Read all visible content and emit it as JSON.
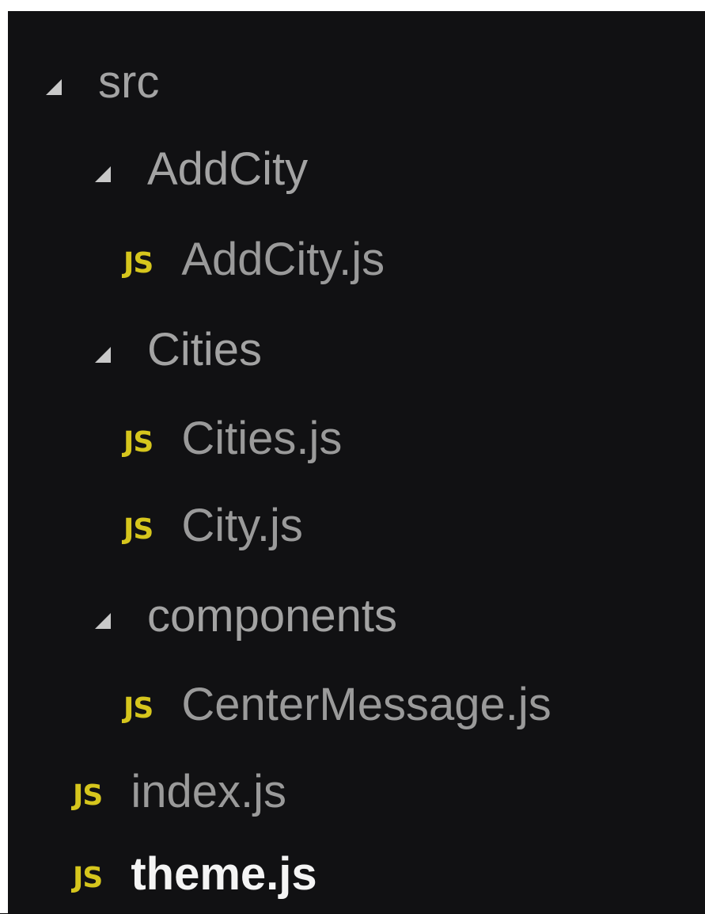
{
  "tree": {
    "src": {
      "label": "src",
      "icon": "chevron-down-icon"
    },
    "addcity_folder": {
      "label": "AddCity",
      "icon": "chevron-down-icon"
    },
    "addcity_js": {
      "label": "AddCity.js",
      "icon": "js-file-icon",
      "badge": "JS"
    },
    "cities_folder": {
      "label": "Cities",
      "icon": "chevron-down-icon"
    },
    "cities_js": {
      "label": "Cities.js",
      "icon": "js-file-icon",
      "badge": "JS"
    },
    "city_js": {
      "label": "City.js",
      "icon": "js-file-icon",
      "badge": "JS"
    },
    "components_folder": {
      "label": "components",
      "icon": "chevron-down-icon"
    },
    "centermessage_js": {
      "label": "CenterMessage.js",
      "icon": "js-file-icon",
      "badge": "JS"
    },
    "index_js": {
      "label": "index.js",
      "icon": "js-file-icon",
      "badge": "JS"
    },
    "theme_js": {
      "label": "theme.js",
      "icon": "js-file-icon",
      "badge": "JS",
      "active": true
    }
  },
  "colors": {
    "background": "#111113",
    "text": "#9a9a9a",
    "active_text": "#f4f4f4",
    "js_badge": "#d6c61d",
    "chevron": "#c9c9c9"
  }
}
